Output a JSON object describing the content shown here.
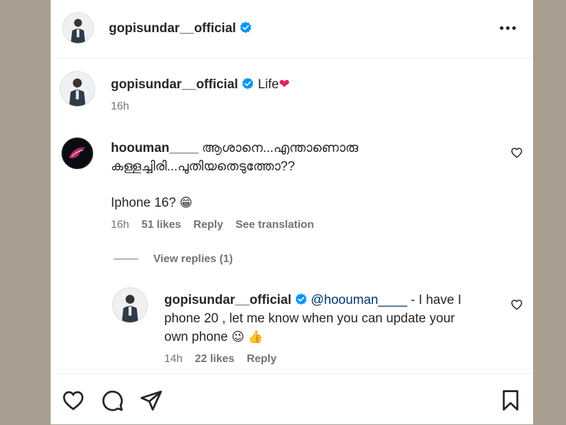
{
  "header": {
    "username": "gopisundar__official",
    "icons": {
      "verified": "verified-badge-icon",
      "more": "more-options-icon"
    }
  },
  "caption": {
    "username": "gopisundar__official",
    "text": "Life",
    "emoji": "❤",
    "time": "16h"
  },
  "comment": {
    "username": "hoouman____",
    "text_line1": "ആശാനെ...എന്താണൊരു",
    "text_line2": "കള്ളച്ചിരി...പുതിയതെടുത്തോ??",
    "text_line3": "Iphone 16?",
    "emoji": "😁",
    "time": "16h",
    "likes": "51 likes",
    "reply_label": "Reply",
    "translate_label": "See translation",
    "view_replies_label": "View replies (1)"
  },
  "reply": {
    "username": "gopisundar__official",
    "mention": "@hoouman____",
    "text_part1": " - I have I",
    "text_line2": "phone 20 , let me know when you can update your",
    "text_line3": "own phone",
    "emojis": "😉 👍",
    "time": "14h",
    "likes": "22 likes",
    "reply_label": "Reply"
  },
  "actions": {
    "icons": [
      "heart-icon",
      "comment-icon",
      "share-icon",
      "bookmark-icon"
    ]
  },
  "colors": {
    "background": "#a89e90",
    "panel": "#ffffff",
    "verified": "#0095f6",
    "heart": "#e0245e",
    "secondary_text": "#737373",
    "mention": "#00376b"
  }
}
